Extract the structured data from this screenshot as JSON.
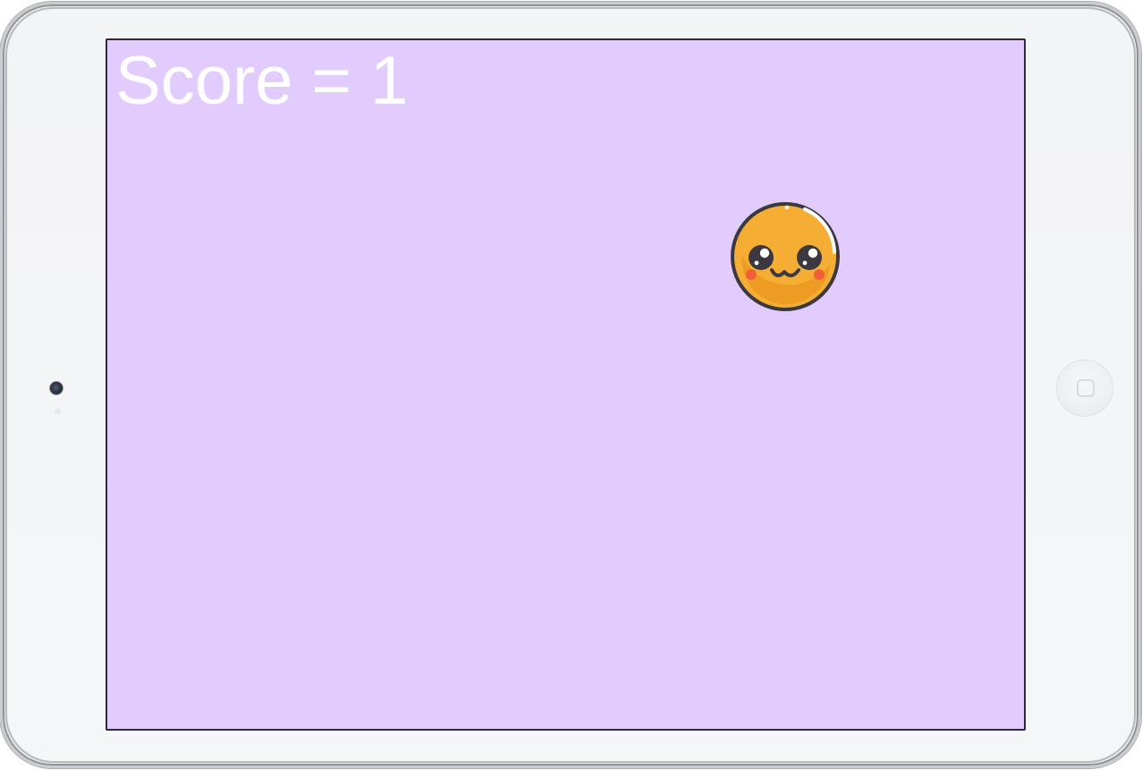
{
  "game": {
    "score_label": "Score = ",
    "score_value": "1",
    "character_icon": "cute-orange-ball-icon",
    "background_color": "#e2cbfd",
    "character_color": "#f5ae33"
  },
  "device": {
    "camera_icon": "front-camera-icon",
    "home_button_icon": "home-button-icon"
  }
}
